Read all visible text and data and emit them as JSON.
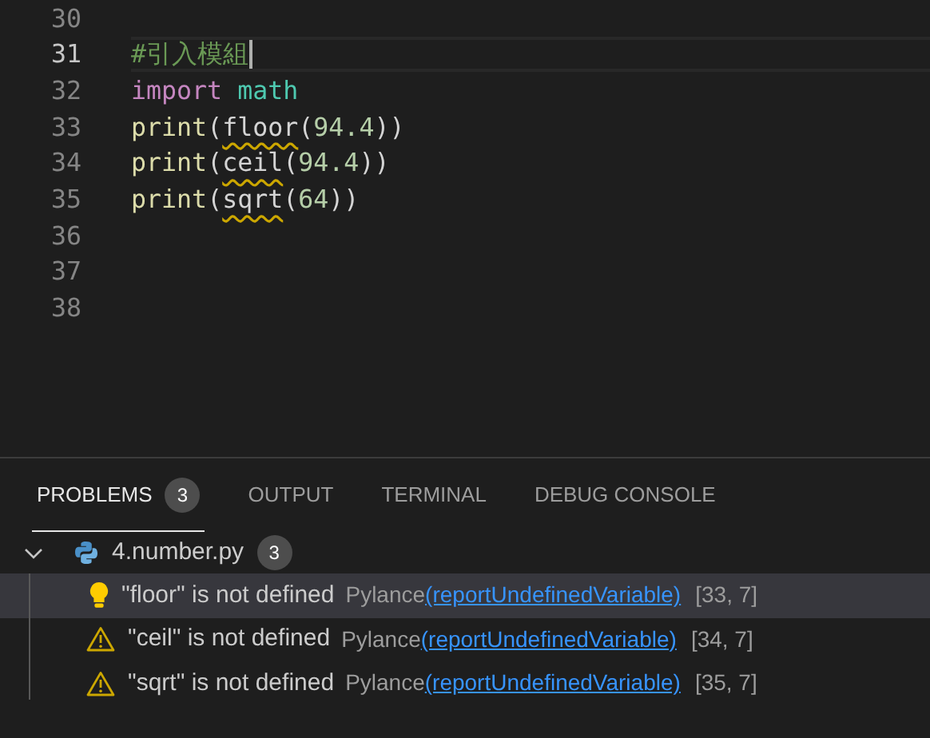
{
  "editor": {
    "lines": [
      {
        "number": "30",
        "current": false
      },
      {
        "number": "31",
        "current": true,
        "tokens": [
          {
            "kind": "comment",
            "text": "#引入模組"
          }
        ]
      },
      {
        "number": "32",
        "current": false,
        "tokens": [
          {
            "kind": "keyword",
            "text": "import"
          },
          {
            "kind": "module",
            "text": "math",
            "space_before": true
          }
        ]
      },
      {
        "number": "33",
        "current": false,
        "tokens": [
          {
            "kind": "function",
            "text": "print"
          },
          {
            "kind": "punct",
            "text": "("
          },
          {
            "kind": "unresolved",
            "text": "floor"
          },
          {
            "kind": "punct",
            "text": "("
          },
          {
            "kind": "number",
            "text": "94.4"
          },
          {
            "kind": "punct",
            "text": "))"
          }
        ]
      },
      {
        "number": "34",
        "current": false,
        "tokens": [
          {
            "kind": "function",
            "text": "print"
          },
          {
            "kind": "punct",
            "text": "("
          },
          {
            "kind": "unresolved",
            "text": "ceil"
          },
          {
            "kind": "punct",
            "text": "("
          },
          {
            "kind": "number",
            "text": "94.4"
          },
          {
            "kind": "punct",
            "text": "))"
          }
        ]
      },
      {
        "number": "35",
        "current": false,
        "tokens": [
          {
            "kind": "function",
            "text": "print"
          },
          {
            "kind": "punct",
            "text": "("
          },
          {
            "kind": "unresolved",
            "text": "sqrt"
          },
          {
            "kind": "punct",
            "text": "("
          },
          {
            "kind": "number",
            "text": "64"
          },
          {
            "kind": "punct",
            "text": "))"
          }
        ]
      },
      {
        "number": "36",
        "current": false
      },
      {
        "number": "37",
        "current": false
      },
      {
        "number": "38",
        "current": false
      }
    ]
  },
  "panel": {
    "tabs": [
      {
        "label": "PROBLEMS",
        "badge": "3",
        "selected": true
      },
      {
        "label": "OUTPUT",
        "selected": false
      },
      {
        "label": "TERMINAL",
        "selected": false
      },
      {
        "label": "DEBUG CONSOLE",
        "selected": false
      }
    ],
    "file": {
      "name": "4.number.py",
      "count": "3",
      "expanded": true
    },
    "problems": [
      {
        "kind": "quickfix",
        "selected": true,
        "message": "\"floor\" is not defined",
        "source": "Pylance",
        "code": "(reportUndefinedVariable)",
        "location": "[33, 7]"
      },
      {
        "kind": "warning",
        "selected": false,
        "message": "\"ceil\" is not defined",
        "source": "Pylance",
        "code": "(reportUndefinedVariable)",
        "location": "[34, 7]"
      },
      {
        "kind": "warning",
        "selected": false,
        "message": "\"sqrt\" is not defined",
        "source": "Pylance",
        "code": "(reportUndefinedVariable)",
        "location": "[35, 7]"
      }
    ]
  }
}
